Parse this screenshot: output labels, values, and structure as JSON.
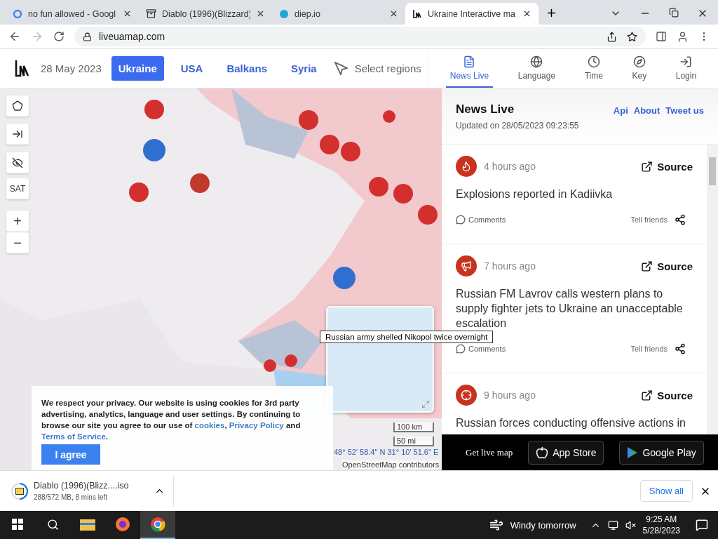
{
  "browser_tabs": [
    {
      "title": "no fun allowed - Googl",
      "kind": "google",
      "selected": false
    },
    {
      "title": "Diablo (1996)(Blizzard)",
      "kind": "archive",
      "selected": false
    },
    {
      "title": "diep.io",
      "kind": "diep",
      "selected": false
    },
    {
      "title": "Ukraine Interactive ma",
      "kind": "lum",
      "selected": true
    }
  ],
  "address_bar": {
    "url": "liveuamap.com"
  },
  "site_header": {
    "date": "28 May 2023",
    "regions": [
      {
        "label": "Ukraine",
        "selected": true
      },
      {
        "label": "USA",
        "selected": false
      },
      {
        "label": "Balkans",
        "selected": false
      },
      {
        "label": "Syria",
        "selected": false
      }
    ],
    "select_regions": "Select regions",
    "nav": [
      {
        "label": "News Live",
        "kind": "news",
        "selected": true
      },
      {
        "label": "Language",
        "kind": "language",
        "selected": false
      },
      {
        "label": "Time",
        "kind": "time",
        "selected": false
      },
      {
        "label": "Key",
        "kind": "key",
        "selected": false
      },
      {
        "label": "Login",
        "kind": "login",
        "selected": false
      }
    ]
  },
  "map": {
    "controls": [
      {
        "kind": "polygon"
      },
      {
        "kind": "arrow"
      },
      {
        "kind": "hide"
      },
      {
        "kind": "text",
        "label": "SAT"
      },
      {
        "kind": "text",
        "label": "+"
      },
      {
        "kind": "text",
        "label": "−"
      }
    ],
    "tooltip": "Russian army shelled Nikopol twice overnight",
    "scale": [
      "100 km",
      "50 mi"
    ],
    "coordinates": "48° 52' 58.4\" N 31° 10' 51.6\" E",
    "attribution": "OpenStreetMap contributors",
    "cookie_banner": {
      "text": "We respect your privacy. Our website is using cookies for 3rd party advertising, analytics, language and user settings. By continuing to browse our site you agree to our use of ",
      "links": [
        "cookies",
        "Privacy Policy",
        "Terms of Service"
      ],
      "joiners": [
        ", ",
        " and ",
        "."
      ],
      "button": "I agree"
    }
  },
  "news_panel": {
    "title": "News Live",
    "updated": "Updated on 28/05/2023 09:23:55",
    "links": [
      "Api",
      "About",
      "Tweet us"
    ],
    "items": [
      {
        "kind": "explosion",
        "time": "4 hours ago",
        "source": "Source",
        "title": "Explosions reported in Kadiivka",
        "comments": "Comments",
        "share": "Tell friends"
      },
      {
        "kind": "megaphone",
        "time": "7 hours ago",
        "source": "Source",
        "title": "Russian FM Lavrov calls western plans to supply fighter jets to Ukraine an unacceptable escalation",
        "comments": "Comments",
        "share": "Tell friends"
      },
      {
        "kind": "weapon",
        "time": "9 hours ago",
        "source": "Source",
        "title": "Russian forces conducting offensive actions in"
      }
    ],
    "app_bar": {
      "label": "Get live map",
      "stores": [
        {
          "kind": "apple",
          "label": "App Store"
        },
        {
          "kind": "google",
          "label": "Google Play"
        }
      ]
    }
  },
  "download_bar": {
    "file": "Diablo (1996)(Blizz....iso",
    "progress": "288/572 MB, 8 mins left",
    "level": 0.5,
    "show_all": "Show all"
  },
  "taskbar": {
    "apps": [
      {
        "kind": "files",
        "selected": false
      },
      {
        "kind": "firefox",
        "selected": false
      },
      {
        "kind": "chrome",
        "selected": true
      }
    ],
    "weather": "Windy tomorrow",
    "time": "9:25 AM",
    "date": "5/28/2023"
  }
}
